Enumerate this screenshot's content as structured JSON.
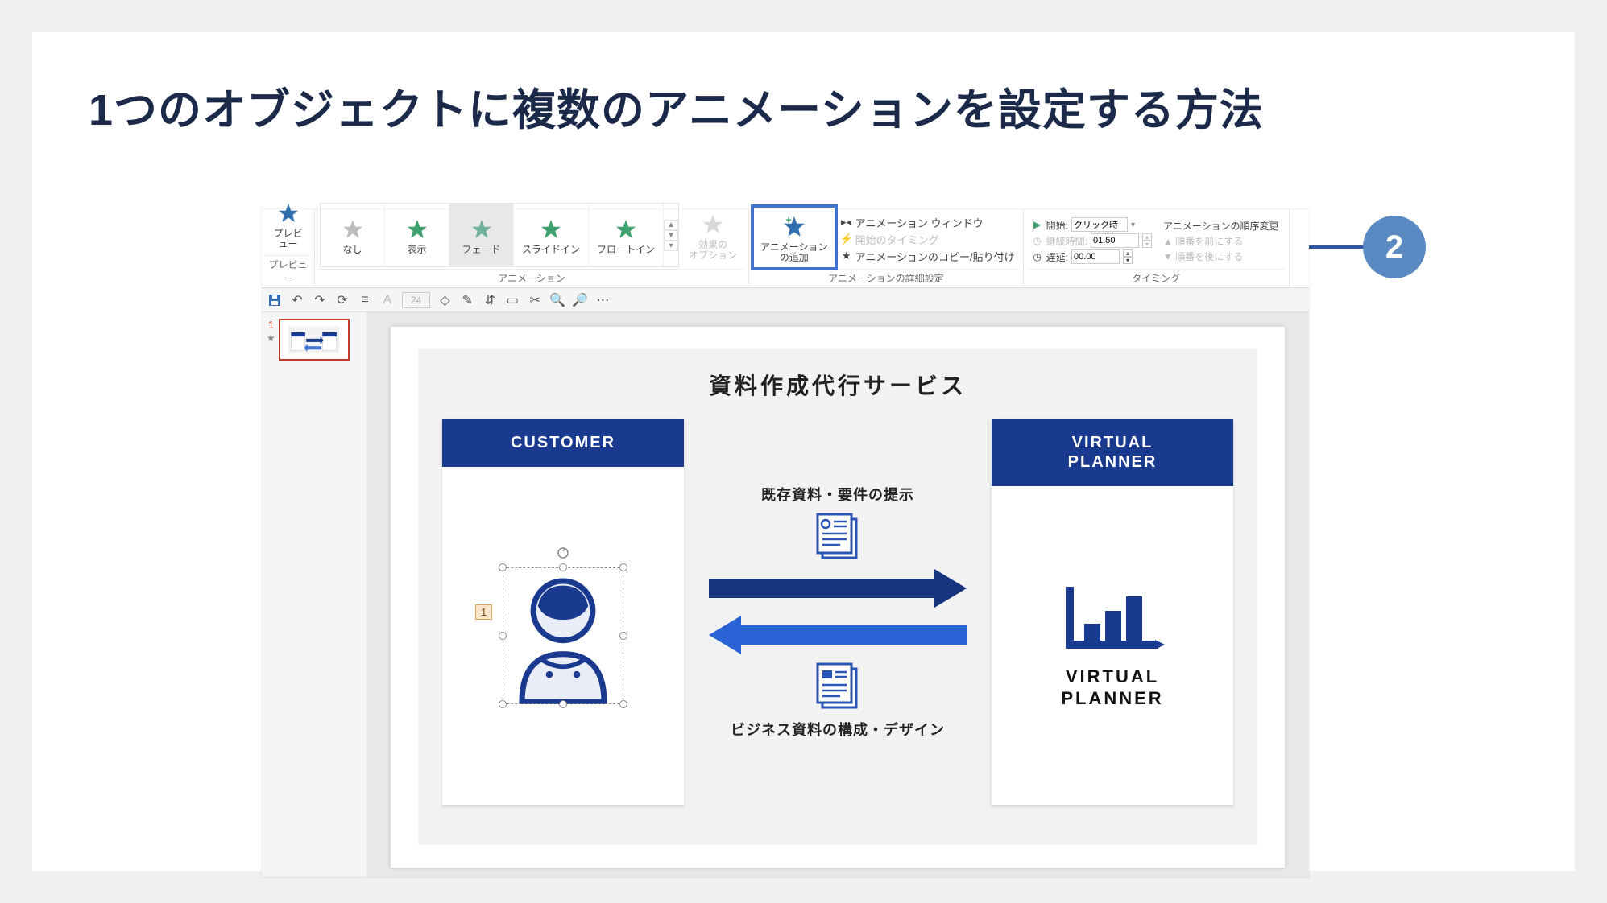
{
  "page_title": "1つのオブジェクトに複数のアニメーションを設定する方法",
  "callout_number": "2",
  "ribbon": {
    "groups": {
      "preview": {
        "label": "プレビュー",
        "button": "プレビュー"
      },
      "animation": {
        "label": "アニメーション",
        "items": [
          "なし",
          "表示",
          "フェード",
          "スライドイン",
          "フロートイン"
        ],
        "options_button": "効果の\nオプション"
      },
      "advanced": {
        "label": "アニメーションの詳細設定",
        "add_button": "アニメーション\nの追加",
        "pane": "アニメーション ウィンドウ",
        "trigger": "開始のタイミング",
        "painter": "アニメーションのコピー/貼り付け"
      },
      "timing": {
        "label": "タイミング",
        "start_label": "開始:",
        "start_value": "クリック時",
        "duration_label": "継続時間:",
        "duration_value": "01.50",
        "delay_label": "遅延:",
        "delay_value": "00.00",
        "order_header": "アニメーションの順序変更",
        "order_earlier": "順番を前にする",
        "order_later": "順番を後にする"
      }
    }
  },
  "qat_fontsize": "24",
  "thumbnail": {
    "number": "1",
    "star": "★"
  },
  "slide": {
    "title": "資料作成代行サービス",
    "left_panel": "CUSTOMER",
    "right_panel_line1": "VIRTUAL",
    "right_panel_line2": "PLANNER",
    "top_label": "既存資料・要件の提示",
    "bottom_label": "ビジネス資料の構成・デザイン",
    "anim_tag": "1",
    "vp_brand_line1": "VIRTUAL",
    "vp_brand_line2": "PLANNER"
  }
}
